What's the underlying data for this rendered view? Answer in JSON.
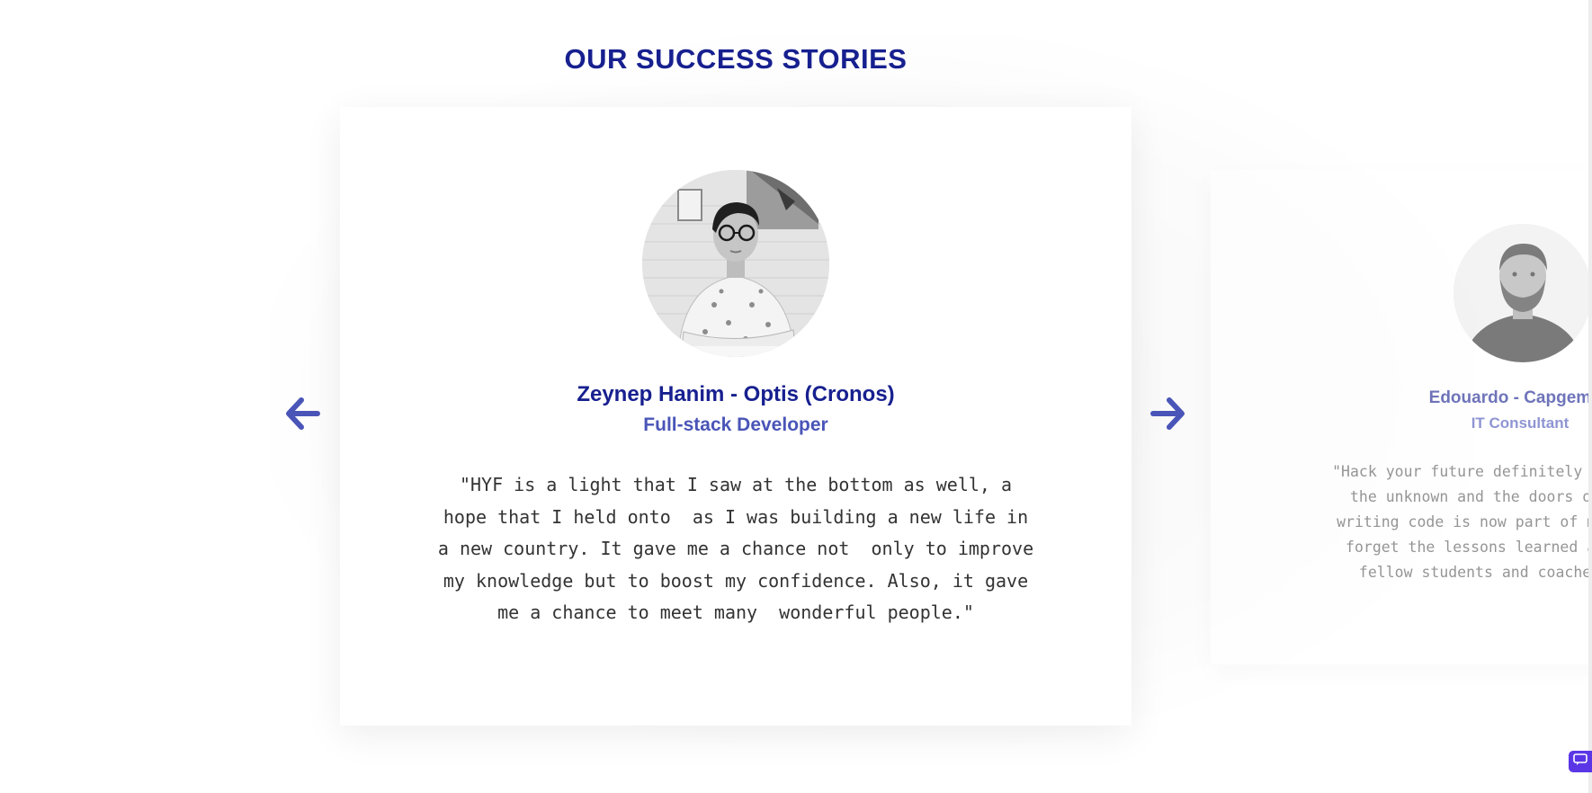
{
  "section": {
    "title": "OUR SUCCESS STORIES"
  },
  "active_story": {
    "name": "Zeynep Hanim - Optis (Cronos)",
    "role": "Full-stack Developer",
    "quote": "\"HYF is a light that I saw at the bottom as well, a\nhope that I held onto  as I was building a new life in\na new country. It gave me a chance not  only to improve\nmy knowledge but to boost my confidence. Also, it gave\nme a chance to meet many  wonderful people.\""
  },
  "next_story": {
    "name": "Edouardo - Capgemini",
    "role": "IT Consultant",
    "quote": "\"Hack your future definitely built\n the unknown and the doors of my\nwriting code is now part of my li\n forget the lessons learned and t\n  fellow students and coaches. A"
  },
  "navigation": {
    "prev_icon": "arrow-left-icon",
    "next_icon": "arrow-right-icon"
  },
  "colors": {
    "title": "#17208f",
    "accent": "#4a55b8",
    "text": "#333333",
    "chat_widget": "#5b36e6"
  }
}
